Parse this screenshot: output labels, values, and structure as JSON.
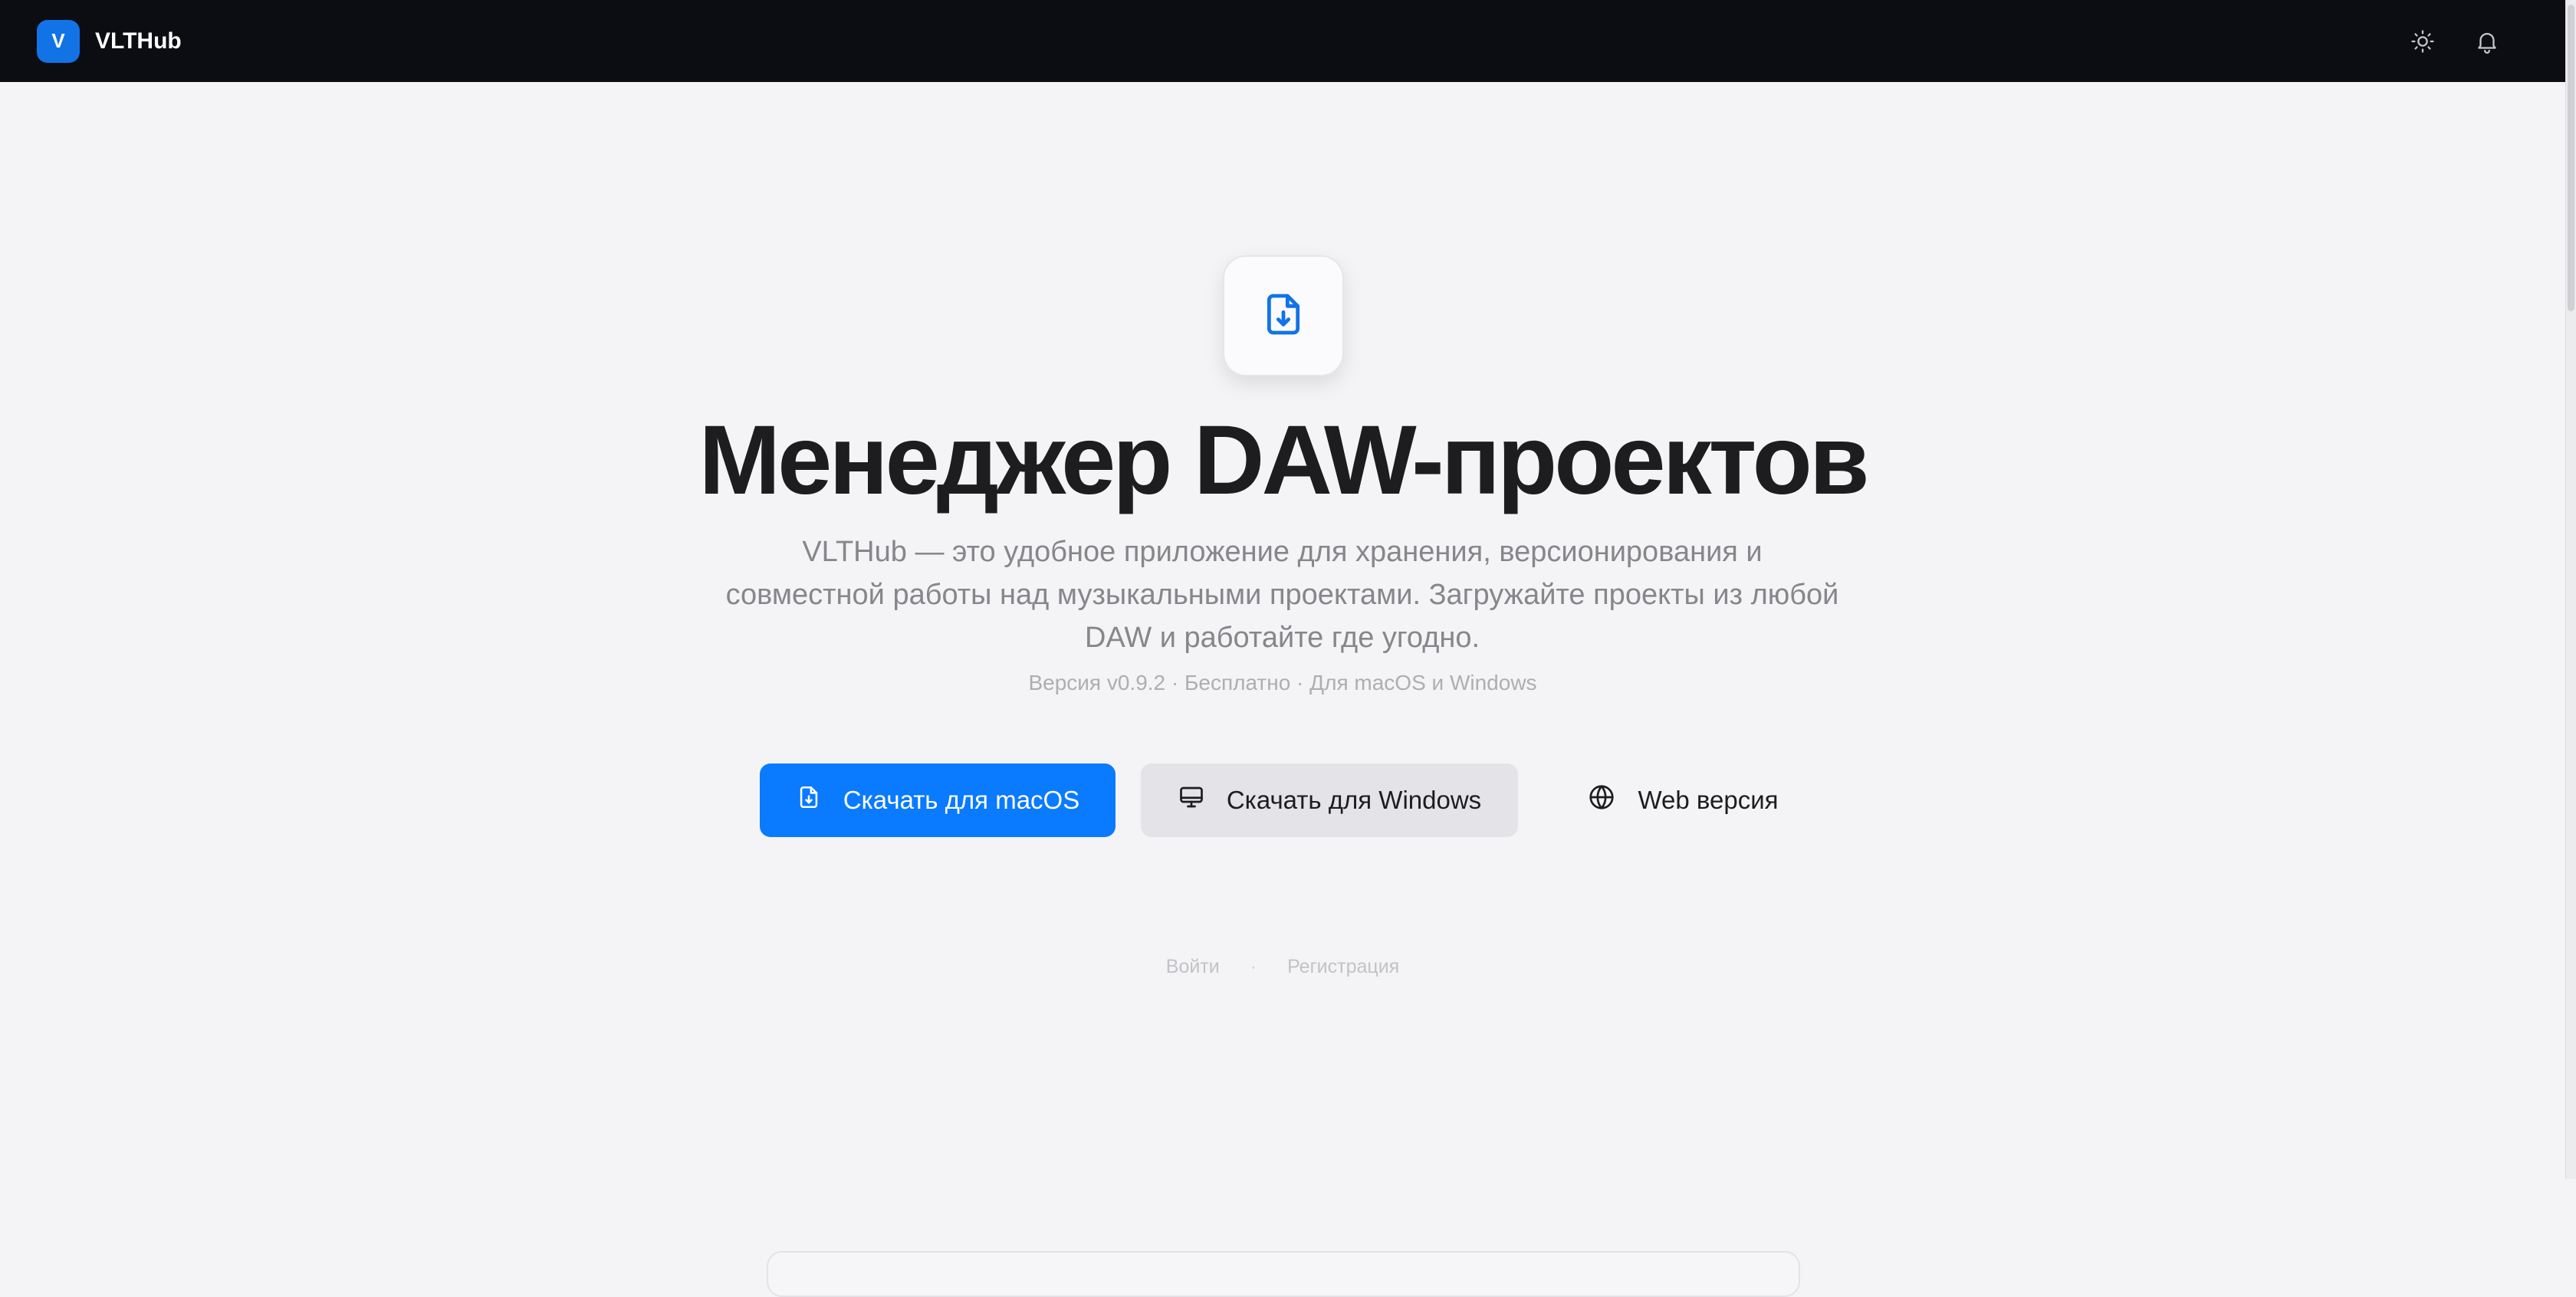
{
  "header": {
    "logo_letter": "V",
    "brand": "VLTHub",
    "theme_icon": "sun-icon",
    "notifications_icon": "bell-icon"
  },
  "hero": {
    "icon": "file-download-icon",
    "title": "Менеджер DAW-проектов",
    "lead": "VLTHub — это удобное приложение для хранения, версионирования и совместной работы над музыкальными проектами. Загружайте проекты из любой DAW и работайте где угодно.",
    "meta": "Версия v0.9.2 · Бесплатно · Для macOS и Windows"
  },
  "actions": {
    "mac_label": "Скачать для macOS",
    "windows_label": "Скачать для Windows",
    "web_label": "Web версия"
  },
  "auth": {
    "login": "Войти",
    "separator": "·",
    "register": "Регистрация"
  },
  "colors": {
    "accent": "#0a7aff",
    "topbar": "#0b0d13",
    "background": "#f4f4f6"
  }
}
